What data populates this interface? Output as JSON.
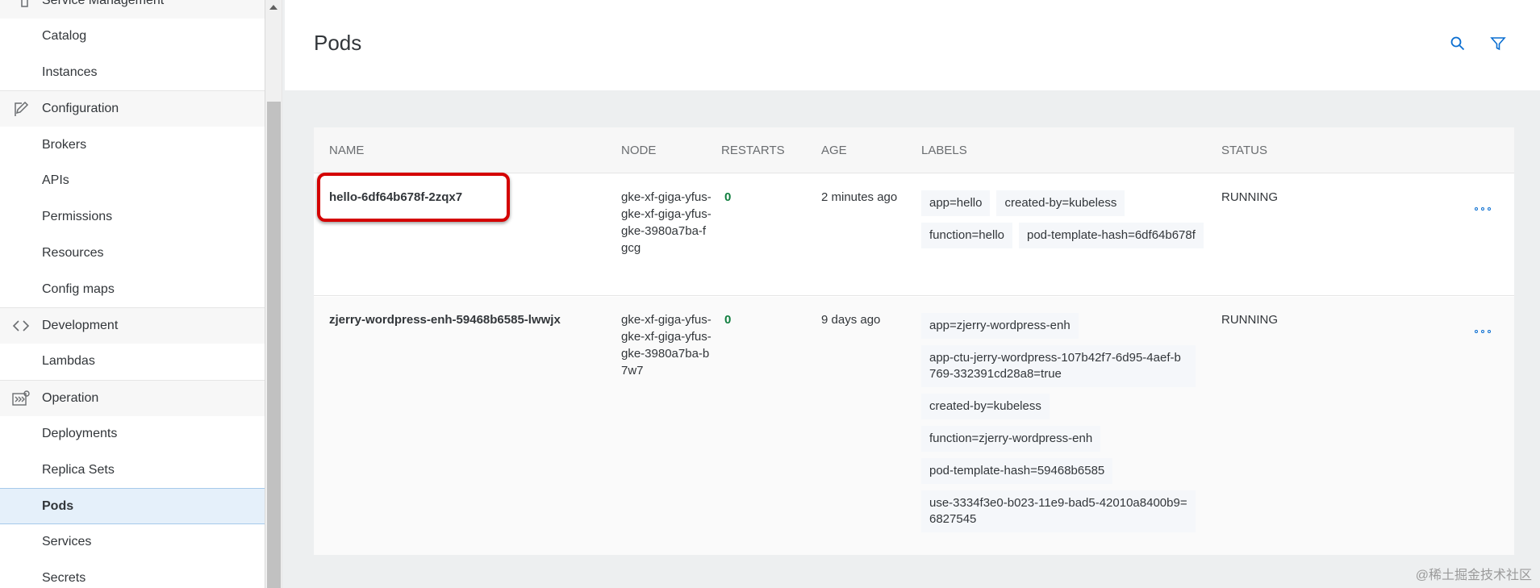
{
  "sidebar": {
    "items": [
      {
        "label": "Service Management",
        "type": "group",
        "icon": "service-icon"
      },
      {
        "label": "Catalog",
        "type": "item"
      },
      {
        "label": "Instances",
        "type": "item"
      },
      {
        "label": "Configuration",
        "type": "group",
        "icon": "edit-icon"
      },
      {
        "label": "Brokers",
        "type": "item"
      },
      {
        "label": "APIs",
        "type": "item"
      },
      {
        "label": "Permissions",
        "type": "item"
      },
      {
        "label": "Resources",
        "type": "item"
      },
      {
        "label": "Config maps",
        "type": "item"
      },
      {
        "label": "Development",
        "type": "group",
        "icon": "code-icon"
      },
      {
        "label": "Lambdas",
        "type": "item"
      },
      {
        "label": "Operation",
        "type": "group",
        "icon": "operation-icon"
      },
      {
        "label": "Deployments",
        "type": "item"
      },
      {
        "label": "Replica Sets",
        "type": "item"
      },
      {
        "label": "Pods",
        "type": "item",
        "active": true
      },
      {
        "label": "Services",
        "type": "item"
      },
      {
        "label": "Secrets",
        "type": "item"
      }
    ]
  },
  "header": {
    "title": "Pods",
    "icons": [
      "search-icon",
      "filter-icon"
    ]
  },
  "table": {
    "columns": {
      "name": "NAME",
      "node": "NODE",
      "restarts": "RESTARTS",
      "age": "AGE",
      "labels": "LABELS",
      "status": "STATUS"
    },
    "rows": [
      {
        "name": "hello-6df64b678f-2zqx7",
        "node": "gke-xf-giga-yfus-gke-xf-giga-yfus-gke-3980a7ba-fgcg",
        "restarts": "0",
        "age": "2 minutes ago",
        "labels": [
          "app=hello",
          "created-by=kubeless",
          "function=hello",
          "pod-template-hash=6df64b678f"
        ],
        "status": "RUNNING"
      },
      {
        "name": "zjerry-wordpress-enh-59468b6585-lwwjx",
        "node": "gke-xf-giga-yfus-gke-xf-giga-yfus-gke-3980a7ba-b7w7",
        "restarts": "0",
        "age": "9 days ago",
        "labels": [
          "app=zjerry-wordpress-enh",
          "app-ctu-jerry-wordpress-107b42f7-6d95-4aef-b769-332391cd28a8=true",
          "created-by=kubeless",
          "function=zjerry-wordpress-enh",
          "pod-template-hash=59468b6585",
          "use-3334f3e0-b023-11e9-bad5-42010a8400b9=6827545"
        ],
        "status": "RUNNING"
      }
    ]
  },
  "watermark": "@稀土掘金技术社区",
  "colors": {
    "accent": "#0a6ed1",
    "highlight": "#d40000",
    "restarts": "#107e3e"
  }
}
